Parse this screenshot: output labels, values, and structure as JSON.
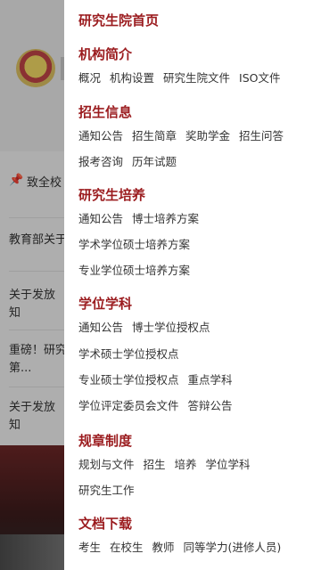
{
  "background": {
    "notice": "致全校",
    "news": [
      "教育部关于",
      "关于发放",
      "知",
      "重磅！研究",
      "第...",
      "关于发放",
      "知"
    ]
  },
  "menu": {
    "home": "研究生院首页",
    "sections": [
      {
        "title": "机构简介",
        "rows": [
          [
            "概况",
            "机构设置",
            "研究生院文件",
            "ISO文件"
          ]
        ]
      },
      {
        "title": "招生信息",
        "rows": [
          [
            "通知公告",
            "招生简章",
            "奖助学金",
            "招生问答"
          ],
          [
            "报考咨询",
            "历年试题"
          ]
        ]
      },
      {
        "title": "研究生培养",
        "rows": [
          [
            "通知公告",
            "博士培养方案"
          ],
          [
            "学术学位硕士培养方案"
          ],
          [
            "专业学位硕士培养方案"
          ]
        ]
      },
      {
        "title": "学位学科",
        "rows": [
          [
            "通知公告",
            "博士学位授权点"
          ],
          [
            "学术硕士学位授权点"
          ],
          [
            "专业硕士学位授权点",
            "重点学科"
          ],
          [
            "学位评定委员会文件",
            "答辩公告"
          ]
        ]
      },
      {
        "title": "规章制度",
        "rows": [
          [
            "规划与文件",
            "招生",
            "培养",
            "学位学科"
          ],
          [
            "研究生工作"
          ]
        ]
      },
      {
        "title": "文档下载",
        "rows": [
          [
            "考生",
            "在校生",
            "教师",
            "同等学力(进修人员)"
          ]
        ]
      }
    ]
  }
}
